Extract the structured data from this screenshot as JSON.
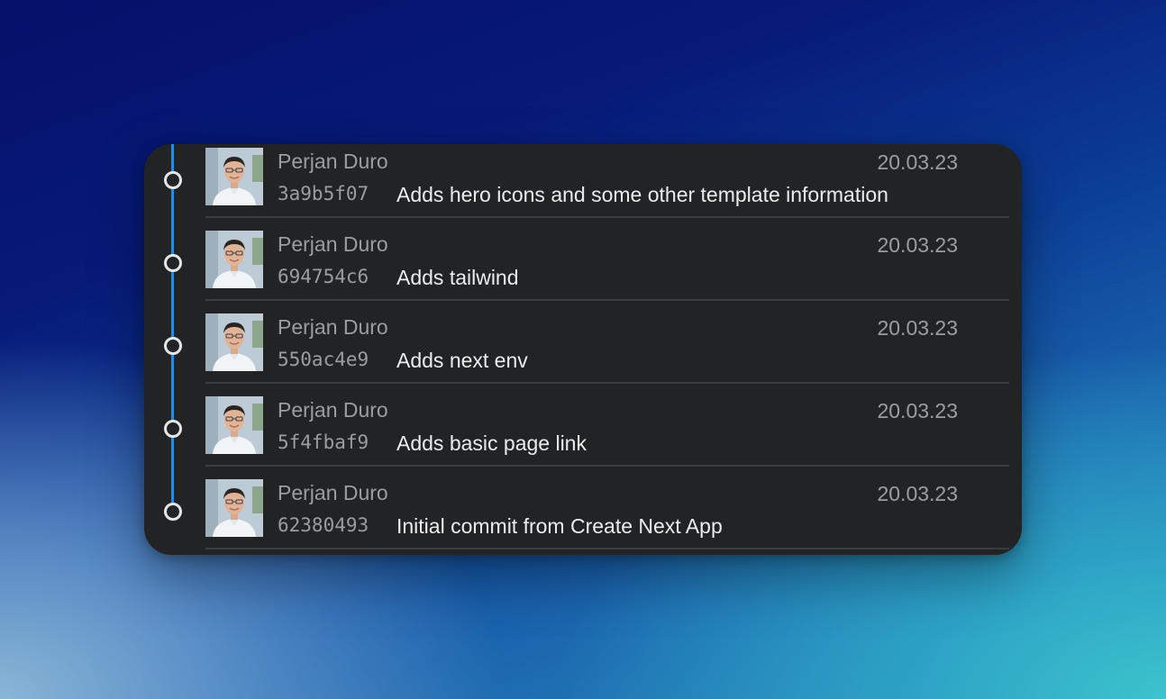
{
  "commits": [
    {
      "author": "Perjan Duro",
      "hash": "3a9b5f07",
      "message": "Adds hero icons and some other template information",
      "date": "20.03.23"
    },
    {
      "author": "Perjan Duro",
      "hash": "694754c6",
      "message": "Adds tailwind",
      "date": "20.03.23"
    },
    {
      "author": "Perjan Duro",
      "hash": "550ac4e9",
      "message": "Adds next env",
      "date": "20.03.23"
    },
    {
      "author": "Perjan Duro",
      "hash": "5f4fbaf9",
      "message": "Adds basic page link",
      "date": "20.03.23"
    },
    {
      "author": "Perjan Duro",
      "hash": "62380493",
      "message": "Initial commit from Create Next App",
      "date": "20.03.23"
    }
  ],
  "icons": {
    "node": "commit-node-icon",
    "avatar": "author-avatar"
  },
  "colors": {
    "branch_line": "#1f8cf0",
    "panel_background": "#212325",
    "muted_text": "#9a9ea3",
    "message_text": "#ececec"
  }
}
